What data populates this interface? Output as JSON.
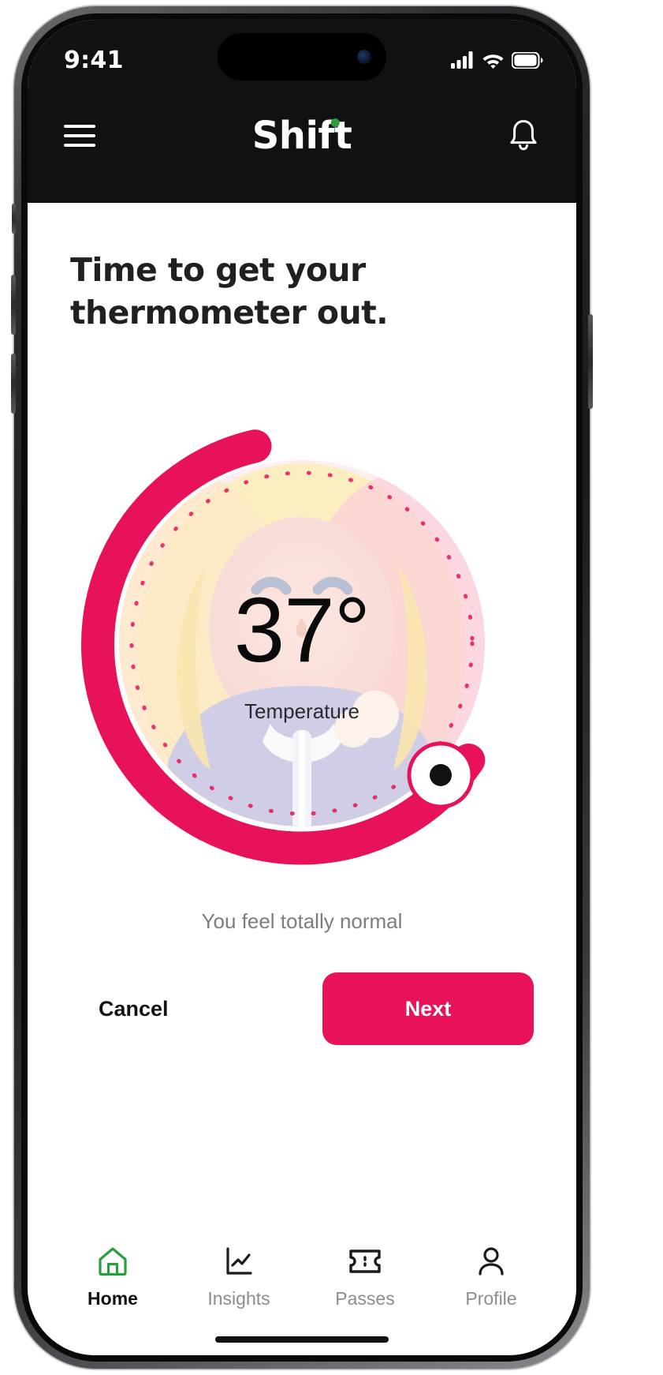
{
  "status_bar": {
    "time": "9:41",
    "cellular_icon": "cellular-signal-icon",
    "wifi_icon": "wifi-icon",
    "battery_icon": "battery-full-icon"
  },
  "nav": {
    "menu_icon": "hamburger-menu-icon",
    "brand": "Shift",
    "notification_icon": "bell-icon"
  },
  "main": {
    "headline": "Time to get your thermometer out.",
    "dial": {
      "value": "37°",
      "label": "Temperature",
      "knob_icon": "dial-knob-handle"
    },
    "status_message": "You feel totally normal"
  },
  "actions": {
    "cancel_label": "Cancel",
    "next_label": "Next"
  },
  "tabs": [
    {
      "label": "Home",
      "icon": "home-icon",
      "active": true
    },
    {
      "label": "Insights",
      "icon": "chart-icon",
      "active": false
    },
    {
      "label": "Passes",
      "icon": "ticket-icon",
      "active": false
    },
    {
      "label": "Profile",
      "icon": "person-icon",
      "active": false
    }
  ],
  "colors": {
    "accent": "#e8125b",
    "header_bg": "#111113",
    "active_tab": "#2a9d3f",
    "inactive_tab": "#8c8c92"
  }
}
